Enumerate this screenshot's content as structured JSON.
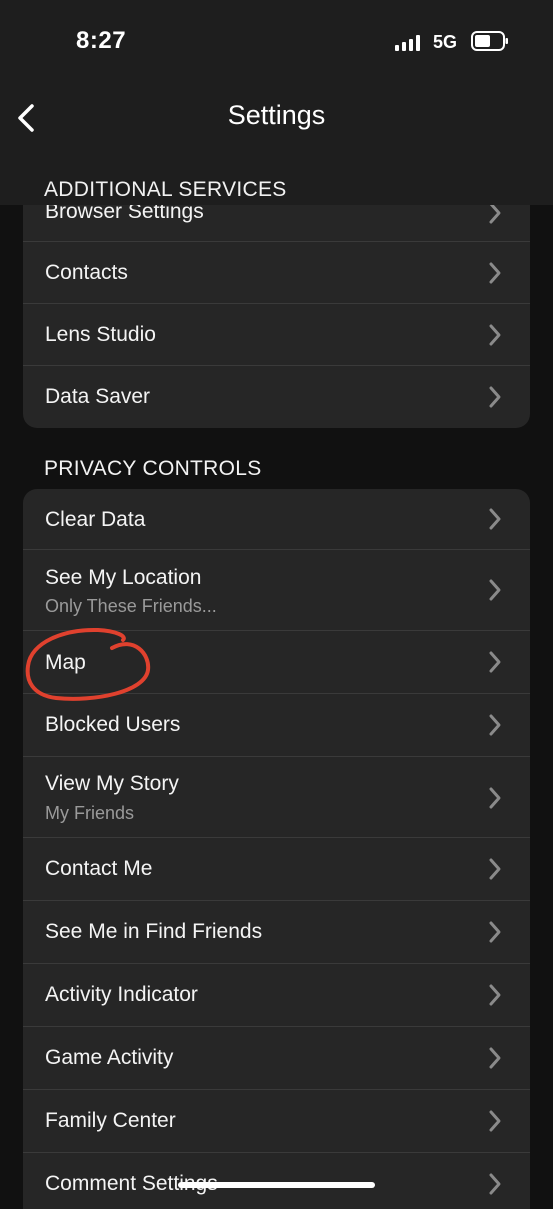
{
  "status_bar": {
    "time": "8:27",
    "network": "5G"
  },
  "header": {
    "title": "Settings"
  },
  "additional_services": {
    "header": "ADDITIONAL SERVICES",
    "items": [
      {
        "label": "Browser Settings"
      },
      {
        "label": "Contacts"
      },
      {
        "label": "Lens Studio"
      },
      {
        "label": "Data Saver"
      }
    ]
  },
  "privacy_controls": {
    "header": "PRIVACY CONTROLS",
    "items": [
      {
        "label": "Clear Data"
      },
      {
        "label": "See My Location",
        "sublabel": "Only These Friends..."
      },
      {
        "label": "Map"
      },
      {
        "label": "Blocked Users"
      },
      {
        "label": "View My Story",
        "sublabel": "My Friends"
      },
      {
        "label": "Contact Me"
      },
      {
        "label": "See Me in Find Friends"
      },
      {
        "label": "Activity Indicator"
      },
      {
        "label": "Game Activity"
      },
      {
        "label": "Family Center"
      },
      {
        "label": "Comment Settings"
      }
    ]
  },
  "colors": {
    "background": "#111111",
    "card": "#262626",
    "header": "#1e1e1e",
    "annotation": "#e0412e"
  }
}
